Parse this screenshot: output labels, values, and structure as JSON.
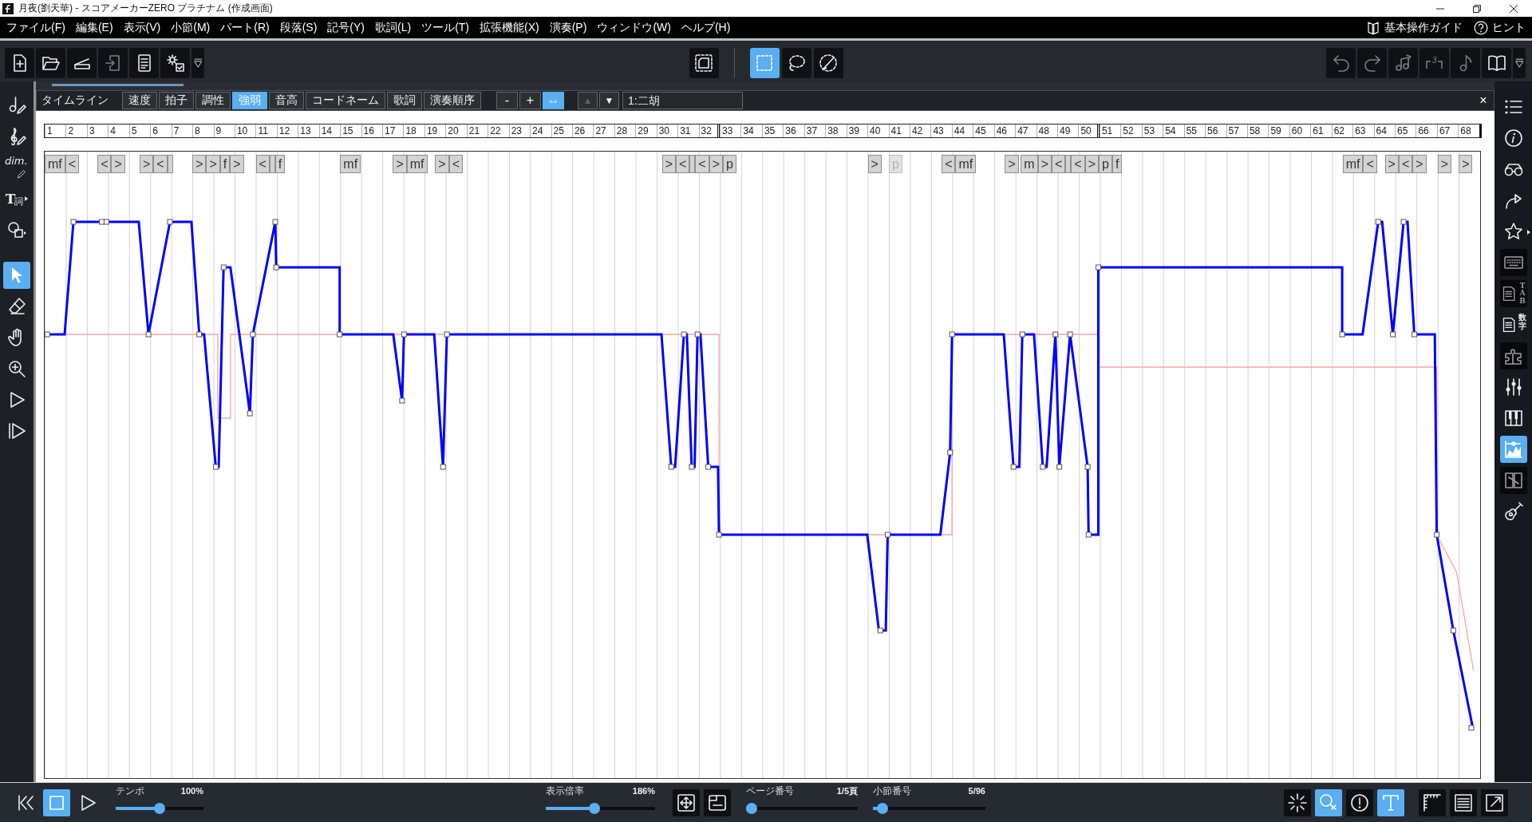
{
  "window": {
    "title": "月夜(劉天華) - スコアメーカーZERO プラチナム (作成画面)"
  },
  "menu_bar": {
    "items": [
      "ファイル(F)",
      "編集(E)",
      "表示(V)",
      "小節(M)",
      "パート(R)",
      "段落(S)",
      "記号(Y)",
      "歌詞(L)",
      "ツール(T)",
      "拡張機能(X)",
      "演奏(P)",
      "ウィンドウ(W)",
      "ヘルプ(H)"
    ],
    "guide": "基本操作ガイド",
    "hint": "ヒント"
  },
  "toolbar": {
    "file_tools": [
      {
        "kind": "new",
        "disabled": false
      },
      {
        "kind": "open",
        "disabled": false
      },
      {
        "kind": "scan",
        "disabled": false
      },
      {
        "kind": "save",
        "disabled": true
      },
      {
        "kind": "list",
        "disabled": false
      },
      {
        "kind": "settings",
        "disabled": false
      },
      {
        "kind": "more",
        "disabled": false
      }
    ],
    "frame_tool": {
      "selected": false
    },
    "select_tools": [
      {
        "kind": "rectangle",
        "selected": true
      },
      {
        "kind": "lasso",
        "selected": false
      },
      {
        "kind": "brush",
        "selected": false
      }
    ],
    "edit_tools": [
      {
        "kind": "undo",
        "disabled": true
      },
      {
        "kind": "redo",
        "disabled": true
      },
      {
        "kind": "notes",
        "disabled": true
      },
      {
        "kind": "triplet",
        "label": "3",
        "disabled": true
      },
      {
        "kind": "note",
        "disabled": true
      },
      {
        "kind": "book",
        "disabled": false
      },
      {
        "kind": "more",
        "disabled": false
      }
    ]
  },
  "left_toolbar": {
    "pen_tools": [
      {
        "kind": "note-pen",
        "selected": false
      },
      {
        "kind": "clef-pen",
        "selected": false
      },
      {
        "kind": "dim-pen",
        "label": "dim.",
        "selected": false
      },
      {
        "kind": "lyric-pen",
        "label": "T詞",
        "selected": false
      },
      {
        "kind": "shape",
        "selected": false
      }
    ],
    "pointer_tools": [
      {
        "kind": "arrow",
        "selected": true
      },
      {
        "kind": "eraser",
        "selected": false
      },
      {
        "kind": "hand",
        "selected": false
      },
      {
        "kind": "zoom",
        "selected": false
      },
      {
        "kind": "play",
        "selected": false
      },
      {
        "kind": "play-from",
        "selected": false
      }
    ]
  },
  "timeline": {
    "title": "タイムライン",
    "tabs": [
      {
        "label": "速度",
        "selected": false
      },
      {
        "label": "拍子",
        "selected": false
      },
      {
        "label": "調性",
        "selected": false
      },
      {
        "label": "強弱",
        "selected": true
      },
      {
        "label": "音高",
        "selected": false
      },
      {
        "label": "コードネーム",
        "selected": false
      },
      {
        "label": "歌詞",
        "selected": false
      },
      {
        "label": "演奏順序",
        "selected": false
      }
    ],
    "zoom_buttons": [
      {
        "label": "-",
        "selected": false
      },
      {
        "label": "+",
        "selected": false
      },
      {
        "label": "⇔",
        "selected": true
      }
    ],
    "nav_buttons": [
      {
        "label": "▲",
        "disabled": true
      },
      {
        "label": "▼",
        "disabled": false
      }
    ],
    "part_field": {
      "value": "1:二胡"
    },
    "close": "×",
    "measures": [
      {
        "n": "1",
        "double_bar": false,
        "dynamics": {
          "kind": "downbeat",
          "disabled": false,
          "marks": [
            {
              "kind": "mark",
              "text": "mf"
            },
            {
              "kind": "mark",
              "text": "<"
            }
          ]
        }
      },
      {
        "n": "2",
        "double_bar": false
      },
      {
        "n": "3",
        "double_bar": false,
        "dynamics": {
          "kind": "third-beat",
          "disabled": false,
          "marks": [
            {
              "kind": "mark",
              "text": "<"
            },
            {
              "kind": "mark",
              "text": ">"
            }
          ]
        }
      },
      {
        "n": "4",
        "double_bar": false
      },
      {
        "n": "5",
        "double_bar": false,
        "dynamics": {
          "kind": "third-beat",
          "disabled": false,
          "marks": [
            {
              "kind": "mark",
              "text": ">"
            },
            {
              "kind": "mark",
              "text": "<"
            },
            {
              "kind": "stub"
            }
          ]
        }
      },
      {
        "n": "6",
        "double_bar": false
      },
      {
        "n": "7",
        "double_bar": false
      },
      {
        "n": "8",
        "double_bar": false,
        "dynamics": {
          "kind": "downbeat",
          "disabled": false,
          "marks": [
            {
              "kind": "mark",
              "text": ">"
            },
            {
              "kind": "mark",
              "text": ">"
            },
            {
              "kind": "mark",
              "text": "f"
            },
            {
              "kind": "mark",
              "text": ">"
            }
          ]
        }
      },
      {
        "n": "9",
        "double_bar": false
      },
      {
        "n": "10",
        "double_bar": false
      },
      {
        "n": "11",
        "double_bar": false,
        "dynamics": {
          "kind": "downbeat",
          "disabled": false,
          "marks": [
            {
              "kind": "mark",
              "text": "<"
            },
            {
              "kind": "stub"
            },
            {
              "kind": "mark",
              "text": "f"
            }
          ]
        }
      },
      {
        "n": "12",
        "double_bar": false
      },
      {
        "n": "13",
        "double_bar": false
      },
      {
        "n": "14",
        "double_bar": false
      },
      {
        "n": "15",
        "double_bar": false,
        "dynamics": {
          "kind": "downbeat",
          "disabled": false,
          "marks": [
            {
              "kind": "mark",
              "text": "mf"
            }
          ]
        }
      },
      {
        "n": "16",
        "double_bar": false
      },
      {
        "n": "17",
        "double_bar": false,
        "dynamics": {
          "kind": "third-beat",
          "disabled": false,
          "marks": [
            {
              "kind": "mark",
              "text": ">"
            },
            {
              "kind": "mark",
              "text": "mf"
            }
          ]
        }
      },
      {
        "n": "18",
        "double_bar": false
      },
      {
        "n": "19",
        "double_bar": false,
        "dynamics": {
          "kind": "third-beat",
          "disabled": false,
          "marks": [
            {
              "kind": "mark",
              "text": ">"
            },
            {
              "kind": "mark",
              "text": "<"
            }
          ]
        }
      },
      {
        "n": "20",
        "double_bar": false
      },
      {
        "n": "21",
        "double_bar": false
      },
      {
        "n": "22",
        "double_bar": false
      },
      {
        "n": "23",
        "double_bar": false
      },
      {
        "n": "24",
        "double_bar": false
      },
      {
        "n": "25",
        "double_bar": false
      },
      {
        "n": "26",
        "double_bar": false
      },
      {
        "n": "27",
        "double_bar": false
      },
      {
        "n": "28",
        "double_bar": false
      },
      {
        "n": "29",
        "double_bar": false
      },
      {
        "n": "30",
        "double_bar": false,
        "dynamics": {
          "kind": "second-beat",
          "disabled": false,
          "marks": [
            {
              "kind": "mark",
              "text": ">"
            },
            {
              "kind": "mark",
              "text": "<"
            },
            {
              "kind": "stub"
            },
            {
              "kind": "mark",
              "text": "<"
            },
            {
              "kind": "mark",
              "text": ">"
            },
            {
              "kind": "mark",
              "text": "p"
            }
          ]
        }
      },
      {
        "n": "31",
        "double_bar": false
      },
      {
        "n": "32",
        "double_bar": true
      },
      {
        "n": "33",
        "double_bar": false
      },
      {
        "n": "34",
        "double_bar": false
      },
      {
        "n": "35",
        "double_bar": false
      },
      {
        "n": "36",
        "double_bar": false
      },
      {
        "n": "37",
        "double_bar": false
      },
      {
        "n": "38",
        "double_bar": false
      },
      {
        "n": "39",
        "double_bar": false
      },
      {
        "n": "40",
        "double_bar": false,
        "dynamics": {
          "kind": "downbeat",
          "disabled": false,
          "marks": [
            {
              "kind": "mark",
              "text": ">"
            }
          ]
        }
      },
      {
        "n": "41",
        "double_bar": false,
        "dynamics": {
          "kind": "downbeat",
          "disabled": true,
          "marks": [
            {
              "kind": "mark",
              "text": "p"
            }
          ]
        }
      },
      {
        "n": "42",
        "double_bar": false
      },
      {
        "n": "43",
        "double_bar": false,
        "dynamics": {
          "kind": "third-beat",
          "disabled": false,
          "marks": [
            {
              "kind": "mark",
              "text": "<"
            },
            {
              "kind": "mark",
              "text": "mf"
            }
          ]
        }
      },
      {
        "n": "44",
        "double_bar": false
      },
      {
        "n": "45",
        "double_bar": false
      },
      {
        "n": "46",
        "double_bar": false,
        "dynamics": {
          "kind": "third-beat",
          "disabled": false,
          "marks": [
            {
              "kind": "mark",
              "text": ">"
            }
          ]
        }
      },
      {
        "n": "47",
        "double_bar": false,
        "dynamics": {
          "kind": "second-beat",
          "disabled": false,
          "marks": [
            {
              "kind": "mark",
              "text": "m"
            },
            {
              "kind": "mark",
              "text": ">"
            },
            {
              "kind": "mark",
              "text": "<"
            },
            {
              "kind": "stub"
            },
            {
              "kind": "mark",
              "text": "<"
            },
            {
              "kind": "mark",
              "text": ">"
            },
            {
              "kind": "mark",
              "text": "p"
            },
            {
              "kind": "mark",
              "text": "f"
            }
          ]
        }
      },
      {
        "n": "48",
        "double_bar": false
      },
      {
        "n": "49",
        "double_bar": false
      },
      {
        "n": "50",
        "double_bar": true
      },
      {
        "n": "51",
        "double_bar": false
      },
      {
        "n": "52",
        "double_bar": false
      },
      {
        "n": "53",
        "double_bar": false
      },
      {
        "n": "54",
        "double_bar": false
      },
      {
        "n": "55",
        "double_bar": false
      },
      {
        "n": "56",
        "double_bar": false
      },
      {
        "n": "57",
        "double_bar": false
      },
      {
        "n": "58",
        "double_bar": false
      },
      {
        "n": "59",
        "double_bar": false
      },
      {
        "n": "60",
        "double_bar": false
      },
      {
        "n": "61",
        "double_bar": false
      },
      {
        "n": "62",
        "double_bar": false,
        "dynamics": {
          "kind": "third-beat",
          "disabled": false,
          "marks": [
            {
              "kind": "mark",
              "text": "mf"
            },
            {
              "kind": "mark",
              "text": "<"
            }
          ]
        }
      },
      {
        "n": "63",
        "double_bar": false
      },
      {
        "n": "64",
        "double_bar": false,
        "dynamics": {
          "kind": "third-beat",
          "disabled": false,
          "marks": [
            {
              "kind": "mark",
              "text": ">"
            },
            {
              "kind": "mark",
              "text": "<"
            },
            {
              "kind": "mark",
              "text": ">"
            }
          ]
        }
      },
      {
        "n": "65",
        "double_bar": false
      },
      {
        "n": "66",
        "double_bar": false
      },
      {
        "n": "67",
        "double_bar": false,
        "dynamics": {
          "kind": "downbeat",
          "disabled": false,
          "marks": [
            {
              "kind": "mark",
              "text": ">"
            }
          ]
        }
      },
      {
        "n": "68",
        "double_bar": false,
        "dynamics": {
          "kind": "downbeat",
          "disabled": false,
          "marks": [
            {
              "kind": "mark",
              "text": ">"
            }
          ]
        }
      }
    ]
  },
  "right_toolbar": {
    "items": [
      {
        "kind": "list",
        "selected": false,
        "open": false
      },
      {
        "kind": "info",
        "selected": false,
        "open": false
      },
      {
        "kind": "glasses",
        "selected": false,
        "open": false
      },
      {
        "kind": "share",
        "selected": false,
        "open": false
      },
      {
        "kind": "star",
        "selected": false,
        "open": false
      },
      {
        "kind": "keyboard",
        "selected": false,
        "open": true
      },
      {
        "kind": "tab",
        "label": "TAB",
        "selected": false,
        "open": true
      },
      {
        "kind": "number",
        "label": "数字",
        "selected": false,
        "open": false
      },
      {
        "kind": "puzzle",
        "selected": false,
        "open": true
      },
      {
        "kind": "mixer",
        "selected": false,
        "open": false
      },
      {
        "kind": "piano",
        "selected": false,
        "open": false
      },
      {
        "kind": "chart",
        "selected": true,
        "open": false
      },
      {
        "kind": "split",
        "selected": false,
        "open": true
      },
      {
        "kind": "guitar",
        "selected": false,
        "open": false
      }
    ]
  },
  "bottom_bar": {
    "transport": [
      {
        "kind": "to-start",
        "selected": false
      },
      {
        "kind": "stop",
        "selected": true
      },
      {
        "kind": "play",
        "selected": false
      }
    ],
    "sliders": [
      {
        "label": "テンポ",
        "reading": "100%",
        "level": 0.5
      },
      {
        "label": "表示倍率",
        "reading": "186%",
        "level": 0.44
      },
      {
        "label": "ページ番号",
        "reading": "1/5頁",
        "level": 0
      },
      {
        "label": "小節番号",
        "reading": "5/96",
        "level": 0.04
      }
    ],
    "view_buttons": [
      {
        "kind": "fit-page"
      },
      {
        "kind": "fit-width"
      }
    ],
    "status_tools": [
      {
        "kind": "sparkle",
        "selected": false
      },
      {
        "kind": "search-off",
        "selected": true
      },
      {
        "kind": "alert",
        "selected": false
      },
      {
        "kind": "text-frame",
        "selected": true
      }
    ],
    "layout_tools": [
      {
        "kind": "ruler"
      },
      {
        "kind": "lines"
      },
      {
        "kind": "expand"
      }
    ]
  }
}
